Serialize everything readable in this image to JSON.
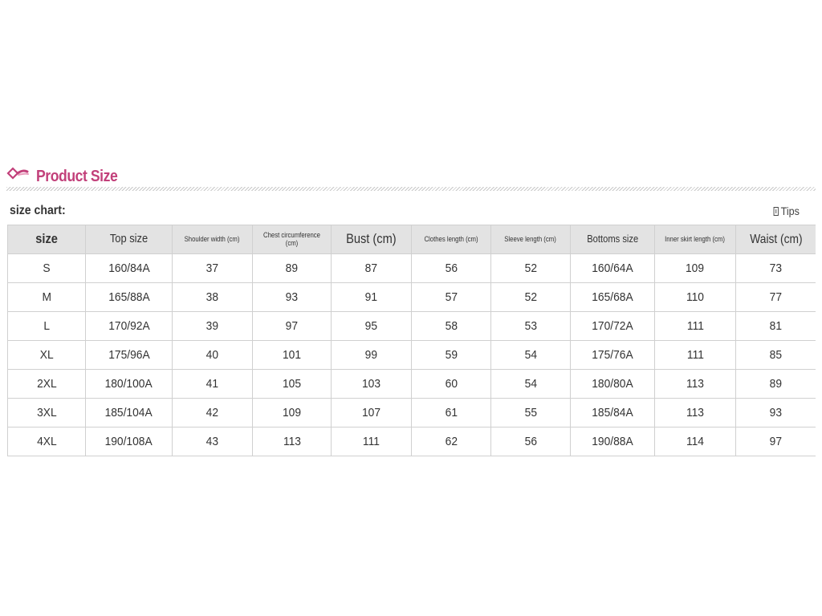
{
  "section": {
    "title": "Product Size",
    "icon": "diamond-arrow-icon",
    "accent_color": "#c2407a"
  },
  "chart_label": "size chart:",
  "tips": {
    "label": "Tips",
    "icon": "info-icon"
  },
  "table": {
    "header_bg": "#e3e3e3",
    "headers": [
      "size",
      "Top size",
      "Shoulder width (cm)",
      "Chest circumference (cm)",
      "Bust (cm)",
      "Clothes length (cm)",
      "Sleeve length (cm)",
      "Bottoms size",
      "Inner skirt length (cm)",
      "Waist (cm)"
    ],
    "rows": [
      [
        "S",
        "160/84A",
        "37",
        "89",
        "87",
        "56",
        "52",
        "160/64A",
        "109",
        "73"
      ],
      [
        "M",
        "165/88A",
        "38",
        "93",
        "91",
        "57",
        "52",
        "165/68A",
        "110",
        "77"
      ],
      [
        "L",
        "170/92A",
        "39",
        "97",
        "95",
        "58",
        "53",
        "170/72A",
        "111",
        "81"
      ],
      [
        "XL",
        "175/96A",
        "40",
        "101",
        "99",
        "59",
        "54",
        "175/76A",
        "111",
        "85"
      ],
      [
        "2XL",
        "180/100A",
        "41",
        "105",
        "103",
        "60",
        "54",
        "180/80A",
        "113",
        "89"
      ],
      [
        "3XL",
        "185/104A",
        "42",
        "109",
        "107",
        "61",
        "55",
        "185/84A",
        "113",
        "93"
      ],
      [
        "4XL",
        "190/108A",
        "43",
        "113",
        "111",
        "62",
        "56",
        "190/88A",
        "114",
        "97"
      ]
    ]
  }
}
